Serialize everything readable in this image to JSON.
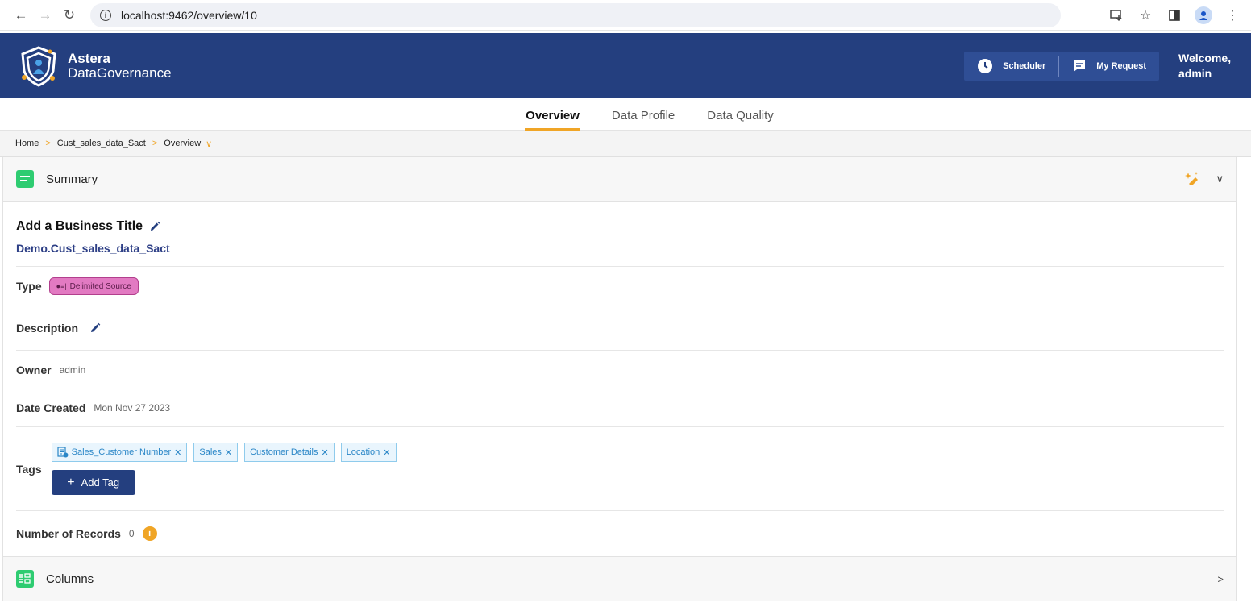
{
  "browser": {
    "url": "localhost:9462/overview/10"
  },
  "header": {
    "logo_line1": "Astera",
    "logo_line2": "DataGovernance",
    "scheduler_label": "Scheduler",
    "my_request_label": "My Request",
    "welcome_line1": "Welcome,",
    "welcome_line2": "admin"
  },
  "tabs": [
    {
      "label": "Overview",
      "active": true
    },
    {
      "label": "Data Profile",
      "active": false
    },
    {
      "label": "Data Quality",
      "active": false
    }
  ],
  "breadcrumb": [
    "Home",
    "Cust_sales_data_Sact",
    "Overview"
  ],
  "summary": {
    "title": "Summary",
    "business_title": "Add a Business Title",
    "qualified_name": "Demo.Cust_sales_data_Sact",
    "type_label": "Type",
    "type_value": "Delimited Source",
    "description_label": "Description",
    "owner_label": "Owner",
    "owner_value": "admin",
    "date_label": "Date Created",
    "date_value": "Mon Nov 27 2023",
    "tags_label": "Tags",
    "tags": [
      "Sales_Customer Number",
      "Sales",
      "Customer Details",
      "Location"
    ],
    "add_tag_label": "Add Tag",
    "records_label": "Number of Records",
    "records_value": "0"
  },
  "columns": {
    "title": "Columns"
  },
  "colors": {
    "header_bg": "#243f7f",
    "accent": "#f0a526",
    "summary_icon": "#2ecc71",
    "type_badge": "#e27ac2",
    "tag_bg": "#e9f5fd"
  }
}
